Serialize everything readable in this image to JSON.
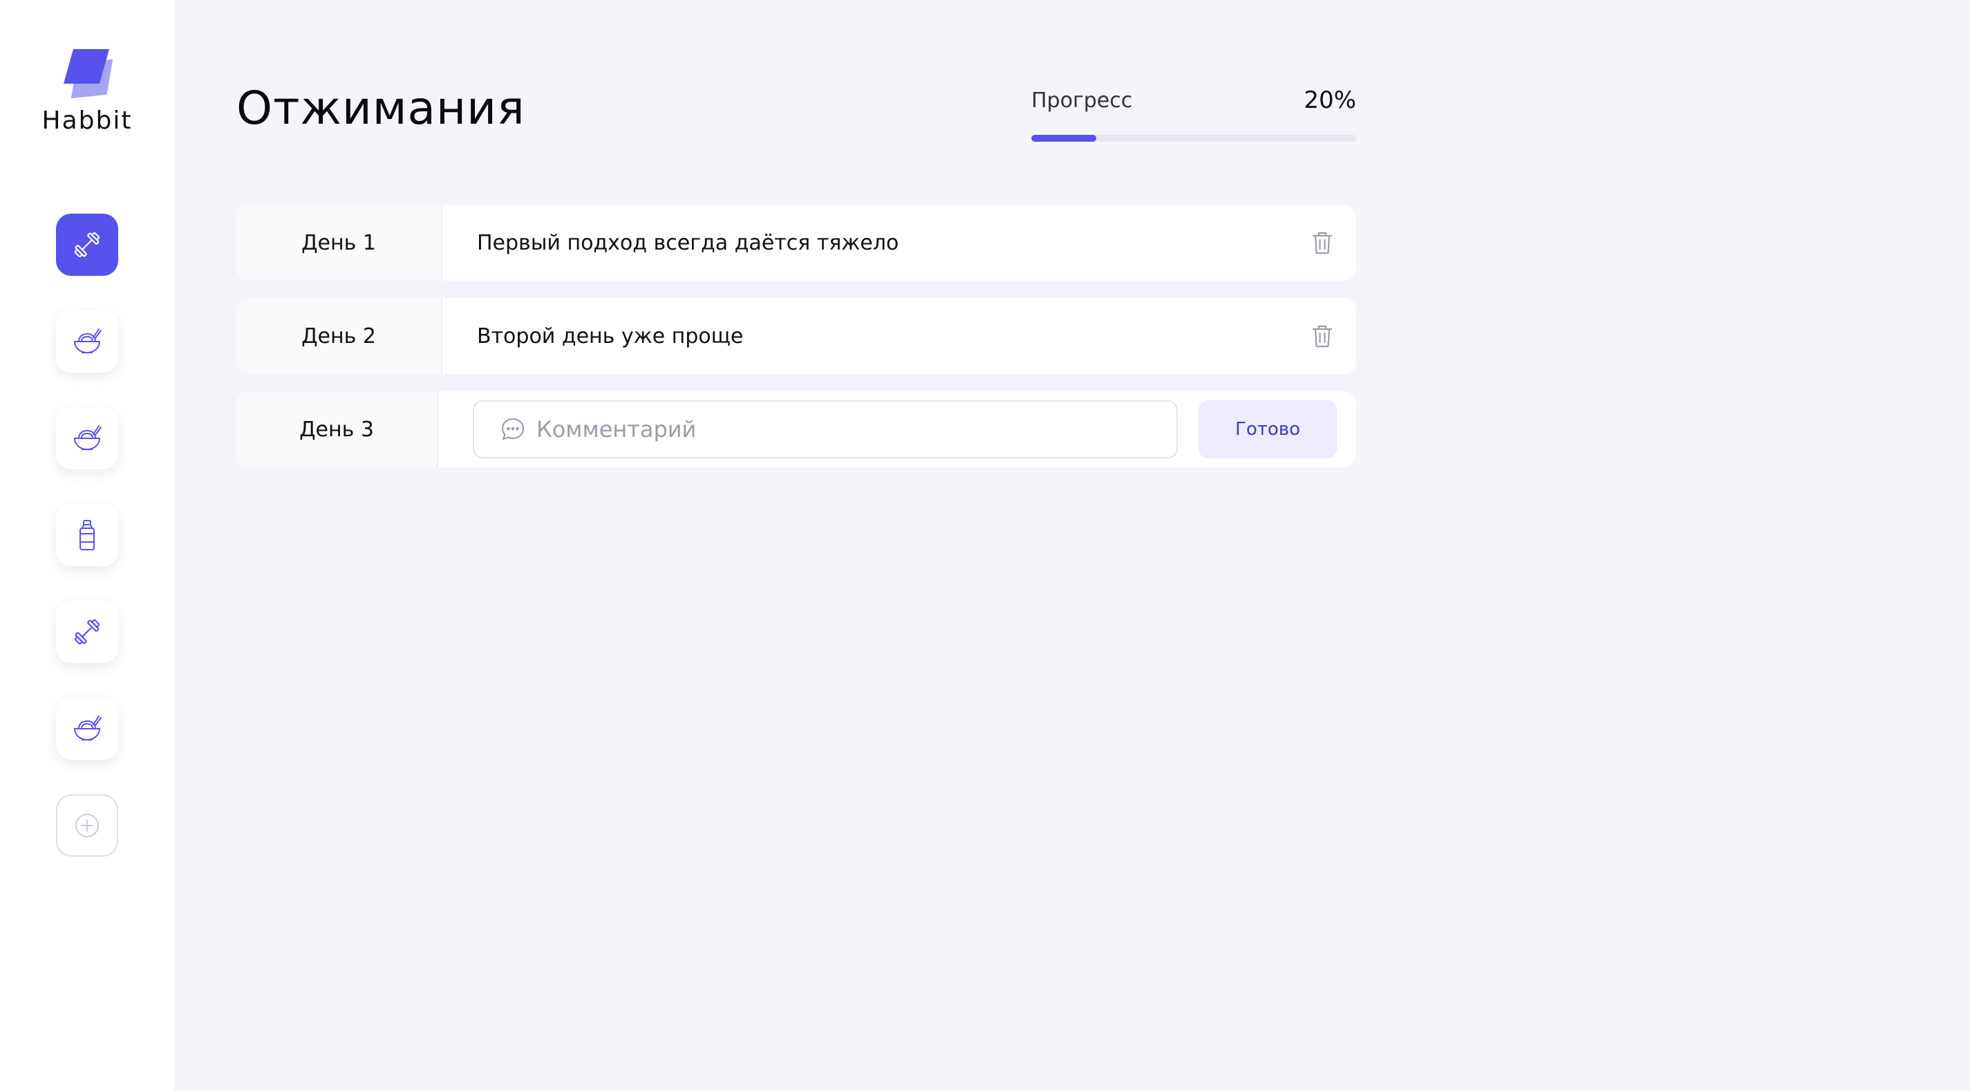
{
  "app": {
    "name": "Habbit"
  },
  "sidebar": {
    "items": [
      {
        "icon": "dumbbell-icon",
        "active": true
      },
      {
        "icon": "food-bowl-icon",
        "active": false
      },
      {
        "icon": "food-bowl-icon",
        "active": false
      },
      {
        "icon": "water-bottle-icon",
        "active": false
      },
      {
        "icon": "dumbbell-icon",
        "active": false
      },
      {
        "icon": "food-bowl-icon",
        "active": false
      }
    ],
    "add_icon": "plus-circle-icon"
  },
  "habit": {
    "title": "Отжимания",
    "progress_label": "Прогресс",
    "progress_text": "20%",
    "progress_value": 0.2
  },
  "days": [
    {
      "label": "День 1",
      "note": "Первый подход всегда даётся тяжело"
    },
    {
      "label": "День 2",
      "note": "Второй день уже проще"
    }
  ],
  "editor": {
    "label": "День 3",
    "value": "",
    "placeholder": "Комментарий",
    "submit_label": "Готово"
  },
  "colors": {
    "accent": "#5652EB",
    "accent_light": "#A7A4F4",
    "background": "#F4F5FA",
    "muted_icon": "#9A9EA8",
    "button_bg": "#EDEBFD"
  }
}
